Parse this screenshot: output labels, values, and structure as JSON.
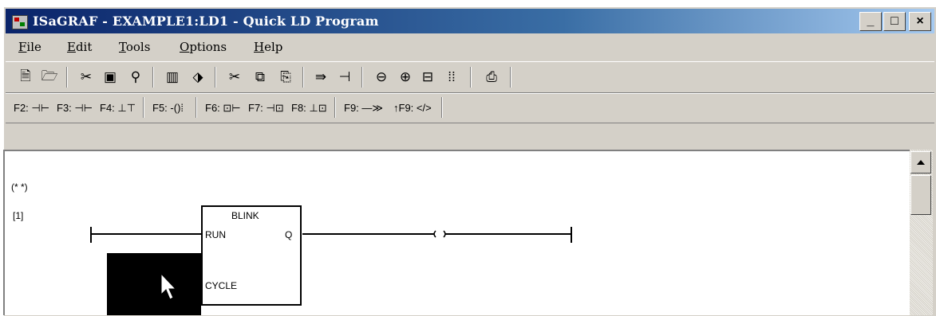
{
  "window": {
    "title": "ISaGRAF - EXAMPLE1:LD1 - Quick LD Program",
    "controls": {
      "minimize": "_",
      "maximize": "□",
      "close": "×"
    }
  },
  "menu": [
    {
      "accel": "F",
      "rest": "ile"
    },
    {
      "accel": "E",
      "rest": "dit"
    },
    {
      "accel": "T",
      "rest": "ools"
    },
    {
      "accel": "O",
      "rest": "ptions"
    },
    {
      "accel": "H",
      "rest": "elp"
    }
  ],
  "function_keys": {
    "f2": "F2:",
    "f3": "F3:",
    "f4": "F4:",
    "f5": "F5:",
    "f6": "F6:",
    "f7": "F7:",
    "f8": "F8:",
    "f9": "F9:",
    "sf9": "↑F9:"
  },
  "editor": {
    "comment": "(* *)",
    "rung_number": "[1]",
    "block": {
      "name": "BLINK",
      "in1": "RUN",
      "in2": "CYCLE",
      "out": "Q"
    }
  }
}
